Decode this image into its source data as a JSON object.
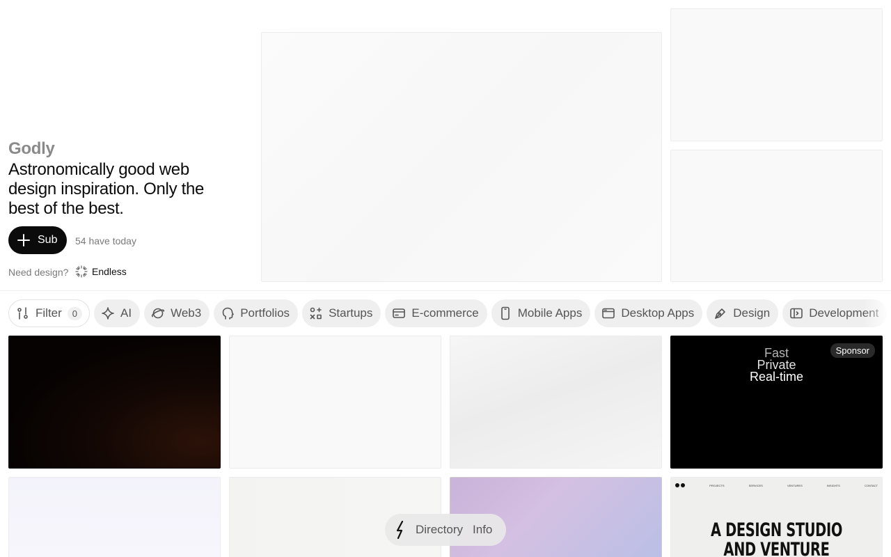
{
  "brand": {
    "name": "Godly",
    "tagline": "Astronomically good web design inspiration. Only the best of the best."
  },
  "subscribe": {
    "label": "Sub",
    "count_text": "54 have today"
  },
  "promo": {
    "question": "Need design?",
    "partner": "Endless"
  },
  "filters": {
    "filter_label": "Filter",
    "filter_count": "0",
    "categories": [
      {
        "label": "AI",
        "icon": "sparkle-icon"
      },
      {
        "label": "Web3",
        "icon": "planet-icon"
      },
      {
        "label": "Portfolios",
        "icon": "head-icon"
      },
      {
        "label": "Startups",
        "icon": "shapes-icon"
      },
      {
        "label": "E-commerce",
        "icon": "credit-card-icon"
      },
      {
        "label": "Mobile Apps",
        "icon": "phone-icon"
      },
      {
        "label": "Desktop Apps",
        "icon": "browser-window-icon"
      },
      {
        "label": "Design",
        "icon": "pen-nib-icon"
      },
      {
        "label": "Development",
        "icon": "code-window-icon"
      }
    ]
  },
  "sponsor_tile": {
    "line1": "Fast",
    "line2": "Private",
    "line3": "Real-time",
    "badge": "Sponsor"
  },
  "studio_tile": {
    "nav": [
      "PROJECTS",
      "SERVICES",
      "VENTURES",
      "INSIGHTS",
      "CONTACT"
    ],
    "headline_1": "A DESIGN STUDIO",
    "headline_2": "AND VENTURE PARTNER"
  },
  "bottom_nav": {
    "directory": "Directory",
    "info": "Info"
  },
  "colors": {
    "text": "#0b0b0b",
    "muted": "#7a7a7a",
    "chip_bg": "#efefef",
    "button_bg": "#0b0b0b"
  }
}
